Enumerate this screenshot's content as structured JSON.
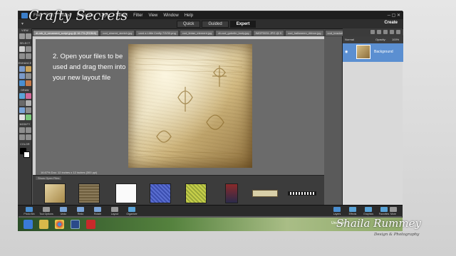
{
  "menu": {
    "items": [
      "File",
      "Edit",
      "Image",
      "Enhance",
      "Layer",
      "Select",
      "Filter",
      "View",
      "Window",
      "Help"
    ]
  },
  "modes": {
    "tabs": [
      {
        "label": "Quick",
        "active": false
      },
      {
        "label": "Guided",
        "active": false
      },
      {
        "label": "Expert",
        "active": true
      }
    ],
    "create_label": "Create"
  },
  "doc_tabs": [
    "dt-mb_it_ornament_script.jpg @ 16.7% (RGB/8)",
    "cod_shared_sketch.jpg",
    "card a Little Crafty 7/3/30.png",
    "cod_tintan_element.jpg",
    "dt-cod_gobelin_body.jpg",
    "IMGP0031.JPG @ 9",
    "cod_halloween_ribbon.jpg",
    "cod_bracket"
  ],
  "toolbox": {
    "sections": [
      "VIEW",
      "SELECT",
      "ENHANCE",
      "DRAW",
      "MODIFY",
      "COLOR"
    ]
  },
  "instruction_text": "2. Open your files to be used and drag them into your new layout file",
  "status_text": "16.67%   Doc: 12 inches x 12 inches (300 ppi)",
  "photo_bin": {
    "label": "Show Open Files",
    "thumbnails": [
      "vintage-paper",
      "burlap-texture",
      "white-card",
      "blue-pattern",
      "green-pattern",
      "photo",
      "label-banner",
      "piano-ribbon"
    ]
  },
  "layers_panel": {
    "blend_mode": "Normal",
    "opacity_label": "Opacity:",
    "opacity_value": "100%",
    "layer_name": "Background"
  },
  "bottom_bar": {
    "left_buttons": [
      "Photo Bin",
      "Tool Options",
      "Undo",
      "Redo",
      "Rotate",
      "Layout",
      "Organizer"
    ],
    "right_buttons": [
      "Layers",
      "Effects",
      "Graphics",
      "Favorites",
      "More"
    ]
  },
  "taskbar": {
    "icons": [
      "ie-icon",
      "folder-icon",
      "chrome-icon",
      "photoshop-elements-icon",
      "pdf-icon"
    ],
    "label_left": "Unsorted"
  },
  "watermarks": {
    "top": "Crafty Secrets",
    "name": "Shaila Rummey",
    "sub": "Design & Photography"
  },
  "colors": {
    "accent": "#5b8fd1",
    "app_bg": "#5a5a5a",
    "toolbox_bg": "#3a3a3a"
  }
}
